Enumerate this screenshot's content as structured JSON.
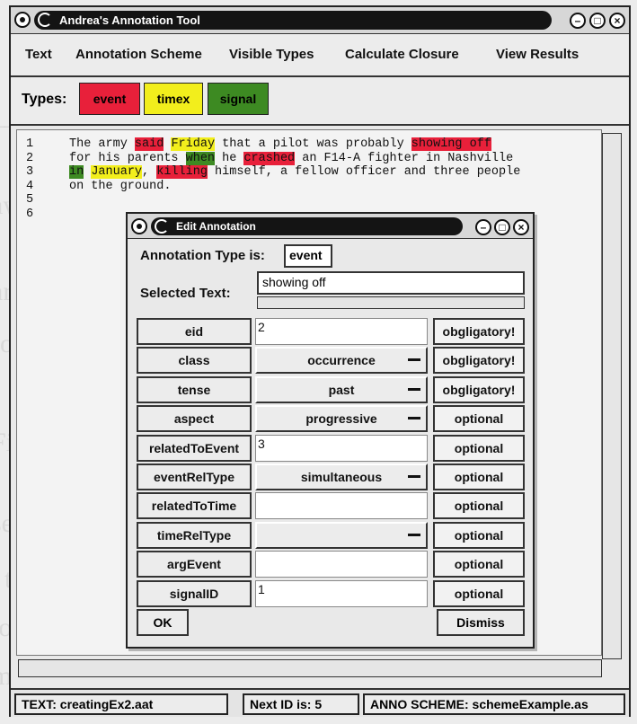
{
  "window": {
    "title": "Andrea's Annotation Tool"
  },
  "menu": [
    "Text",
    "Annotation Scheme",
    "Visible Types",
    "Calculate Closure",
    "View Results"
  ],
  "types": {
    "label": "Types:",
    "items": [
      {
        "name": "event",
        "color": "#e8203a"
      },
      {
        "name": "timex",
        "color": "#f2ee1c"
      },
      {
        "name": "signal",
        "color": "#3d8a22"
      }
    ]
  },
  "editor": {
    "line_numbers": [
      "1",
      "2",
      "3",
      "4",
      "5",
      "6"
    ],
    "lines": [
      [
        {
          "t": "The army "
        },
        {
          "t": "said",
          "hl": "event"
        },
        {
          "t": " "
        },
        {
          "t": "Friday",
          "hl": "timex"
        },
        {
          "t": " that a pilot was probably "
        },
        {
          "t": "showing off",
          "hl": "event"
        }
      ],
      [
        {
          "t": "for his parents "
        },
        {
          "t": "when",
          "hl": "signal"
        },
        {
          "t": " he "
        },
        {
          "t": "crashed",
          "hl": "event"
        },
        {
          "t": " an F14-A fighter in Nashville"
        }
      ],
      [
        {
          "t": "in",
          "hl": "signal"
        },
        {
          "t": " "
        },
        {
          "t": "January",
          "hl": "timex"
        },
        {
          "t": ", "
        },
        {
          "t": "killing",
          "hl": "event"
        },
        {
          "t": " himself, a fellow officer and three people"
        }
      ],
      [
        {
          "t": "on the ground."
        }
      ],
      [],
      []
    ]
  },
  "status": {
    "text_file": "TEXT: creatingEx2.aat",
    "next_id": "Next ID is: 5",
    "scheme": "ANNO SCHEME: schemeExample.as"
  },
  "dialog": {
    "title": "Edit Annotation",
    "annotation_type_label": "Annotation Type is:",
    "annotation_type_value": "event",
    "selected_text_label": "Selected Text:",
    "selected_text_value": "showing off",
    "attributes": [
      {
        "name": "eid",
        "value": "2",
        "kind": "text",
        "req": "obgligatory!"
      },
      {
        "name": "class",
        "value": "occurrence",
        "kind": "dropdown",
        "req": "obgligatory!"
      },
      {
        "name": "tense",
        "value": "past",
        "kind": "dropdown",
        "req": "obgligatory!"
      },
      {
        "name": "aspect",
        "value": "progressive",
        "kind": "dropdown",
        "req": "optional"
      },
      {
        "name": "relatedToEvent",
        "value": "3",
        "kind": "text",
        "req": "optional"
      },
      {
        "name": "eventRelType",
        "value": "simultaneous",
        "kind": "dropdown",
        "req": "optional"
      },
      {
        "name": "relatedToTime",
        "value": "",
        "kind": "text",
        "req": "optional"
      },
      {
        "name": "timeRelType",
        "value": "",
        "kind": "dropdown",
        "req": "optional"
      },
      {
        "name": "argEvent",
        "value": "",
        "kind": "text",
        "req": "optional"
      },
      {
        "name": "signalID",
        "value": "1",
        "kind": "text",
        "req": "optional"
      }
    ],
    "ok_label": "OK",
    "dismiss_label": "Dismiss"
  }
}
